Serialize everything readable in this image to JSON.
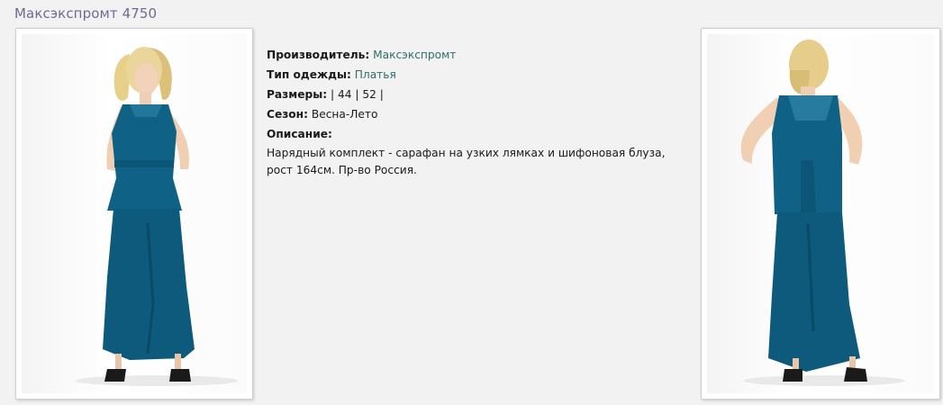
{
  "page": {
    "title": "Максэкспромт 4750"
  },
  "info": {
    "manufacturer_label": "Производитель:",
    "manufacturer_value": "Максэкспромт",
    "type_label": "Тип одежды:",
    "type_value": "Платья",
    "sizes_label": "Размеры:",
    "sizes_prefix": "|",
    "sizes": [
      "44",
      "52"
    ],
    "sizes_sep": "|",
    "season_label": "Сезон:",
    "season_value": "Весна-Лето",
    "description_label": "Описание:",
    "description_text": "Нарядный комплект - сарафан на узких лямках и шифоновая блуза, рост 164см. Пр-во Россия."
  },
  "photos": {
    "front": {
      "icon": "dress-front-photo"
    },
    "back": {
      "icon": "dress-back-photo"
    }
  },
  "colors": {
    "dress": "#0f6286",
    "title": "#6f6a93",
    "link": "#2f6f6b"
  }
}
